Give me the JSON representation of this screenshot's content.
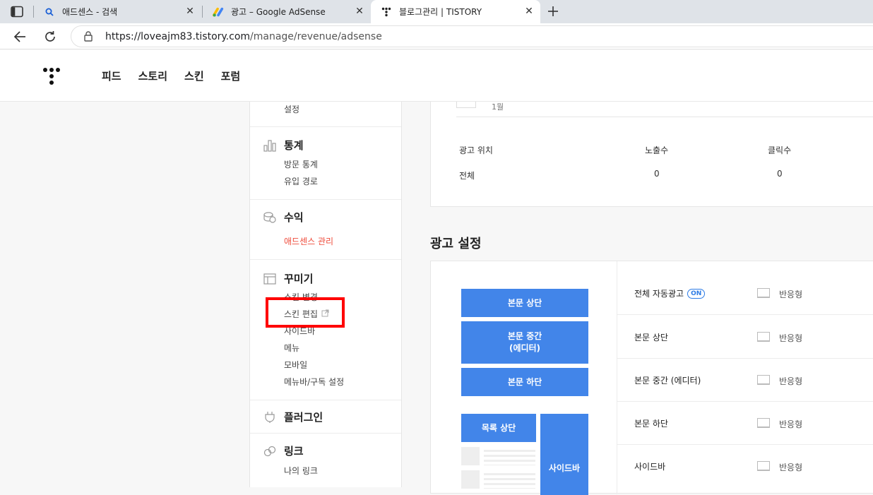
{
  "browser": {
    "tabs": [
      {
        "title": "애드센스 - 검색",
        "icon": "search-icon"
      },
      {
        "title": "광고 – Google AdSense",
        "icon": "adsense-logo-icon"
      },
      {
        "title": "블로그관리 | TISTORY",
        "icon": "tistory-icon"
      }
    ],
    "url_host": "https://loveajm83.tistory.com",
    "url_path": "/manage/revenue/adsense"
  },
  "header": {
    "nav": [
      "피드",
      "스토리",
      "스킨",
      "포럼"
    ]
  },
  "sidebar": {
    "settings_item": "설정",
    "stats": {
      "title": "통계",
      "items": [
        "방문 통계",
        "유입 경로"
      ]
    },
    "revenue": {
      "title": "수익",
      "items": [
        "애드센스 관리"
      ]
    },
    "decorate": {
      "title": "꾸미기",
      "items": [
        "스킨 변경",
        "스킨 편집",
        "사이드바",
        "메뉴",
        "모바일",
        "메뉴바/구독 설정"
      ]
    },
    "plugin": {
      "title": "플러그인"
    },
    "link": {
      "title": "링크",
      "items": [
        "나의 링크"
      ]
    }
  },
  "stats_card": {
    "month": "1월",
    "headers": [
      "광고 위치",
      "노출수",
      "클릭수"
    ],
    "row": [
      "전체",
      "0",
      "0"
    ]
  },
  "ad_settings": {
    "title": "광고 설정",
    "preview": {
      "top": "본문 상단",
      "middle": "본문 중간\n(에디터)",
      "bottom": "본문 하단",
      "list_top": "목록 상단",
      "sidebar": "사이드바"
    },
    "rows": [
      {
        "label": "전체 자동광고",
        "badge": "ON",
        "type": "반응형"
      },
      {
        "label": "본문 상단",
        "badge": "",
        "type": "반응형"
      },
      {
        "label": "본문 중간 (에디터)",
        "badge": "",
        "type": "반응형"
      },
      {
        "label": "본문 하단",
        "badge": "",
        "type": "반응형"
      },
      {
        "label": "사이드바",
        "badge": "",
        "type": "반응형"
      }
    ]
  },
  "colors": {
    "accent_blue": "#4285e9",
    "red_highlight": "#ff0000",
    "active_link": "#ef4b3b"
  }
}
